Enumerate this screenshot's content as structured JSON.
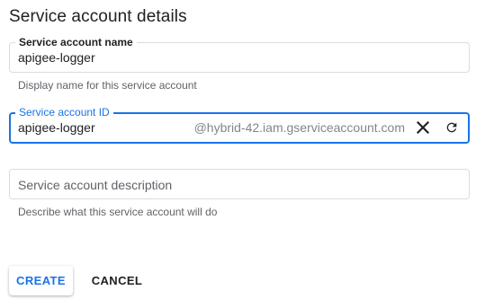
{
  "heading": "Service account details",
  "name_field": {
    "label": "Service account name",
    "value": "apigee-logger",
    "helper": "Display name for this service account"
  },
  "id_field": {
    "label": "Service account ID",
    "value": "apigee-logger",
    "suffix": "@hybrid-42.iam.gserviceaccount.com",
    "clear_icon": "close-icon",
    "refresh_icon": "refresh-icon",
    "accent_color": "#1a73e8"
  },
  "description_field": {
    "placeholder": "Service account description",
    "helper": "Describe what this service account will do"
  },
  "buttons": {
    "create": "CREATE",
    "cancel": "CANCEL"
  }
}
